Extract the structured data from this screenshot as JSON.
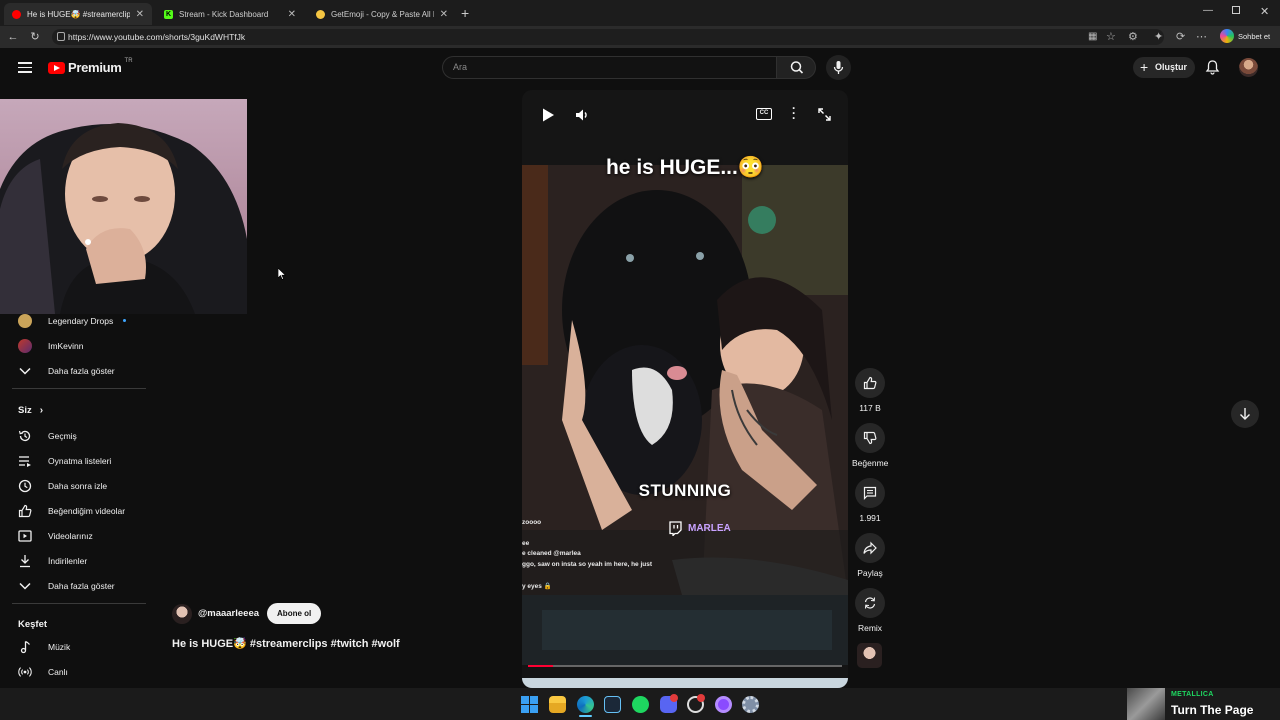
{
  "browser": {
    "tabs": [
      {
        "title": "He is HUGE🤯 #streamerclips #twitch #wolf"
      },
      {
        "title": "Stream - Kick Dashboard"
      },
      {
        "title": "GetEmoji - Copy & Paste All Emojis"
      }
    ],
    "url": "https://www.youtube.com/shorts/3guKdWHTfJk",
    "copilot_label": "Sohbet et"
  },
  "youtube": {
    "logo_text": "Premium",
    "logo_badge": "TR",
    "search_placeholder": "Ara",
    "create_label": "Oluştur"
  },
  "sidebar": {
    "subs": [
      {
        "label": "Legendary Drops"
      },
      {
        "label": "ImKevinn"
      },
      {
        "label": "Daha fazla göster"
      }
    ],
    "you_header": "Siz",
    "you_items": [
      {
        "label": "Geçmiş",
        "icon": "history-icon"
      },
      {
        "label": "Oynatma listeleri",
        "icon": "playlist-icon"
      },
      {
        "label": "Daha sonra izle",
        "icon": "clock-icon"
      },
      {
        "label": "Beğendiğim videolar",
        "icon": "thumb-up-icon"
      },
      {
        "label": "Videolarınız",
        "icon": "video-icon"
      },
      {
        "label": "İndirilenler",
        "icon": "download-icon"
      },
      {
        "label": "Daha fazla göster",
        "icon": "chevron-down-icon"
      }
    ],
    "explore_header": "Keşfet",
    "explore_items": [
      {
        "label": "Müzik",
        "icon": "music-icon"
      },
      {
        "label": "Canlı",
        "icon": "live-icon"
      }
    ]
  },
  "short": {
    "overlay_title": "he is HUGE...😳",
    "overlay_word": "STUNNING",
    "twitch_name": "MARLEA",
    "chat_lines": [
      "zoooo",
      "ee",
      "e cleaned @marlea",
      "ggo, saw on insta so yeah im here, he just",
      "y eyes 🔒"
    ],
    "channel": "@maaarleeea",
    "subscribe_label": "Abone ol",
    "title": "He is HUGE🤯 #streamerclips #twitch #wolf",
    "progress": 0.08
  },
  "actions": {
    "likes": "117 B",
    "dislike_label": "Beğenme",
    "comments": "1.991",
    "share_label": "Paylaş",
    "remix_label": "Remix"
  },
  "nowplaying": {
    "artist": "METALLICA",
    "track": "Turn The Page"
  },
  "colors": {
    "yt_red": "#ff0000",
    "kick_green": "#53fc18",
    "twitch_purple": "#9146ff",
    "progress_red": "#ff0033"
  }
}
